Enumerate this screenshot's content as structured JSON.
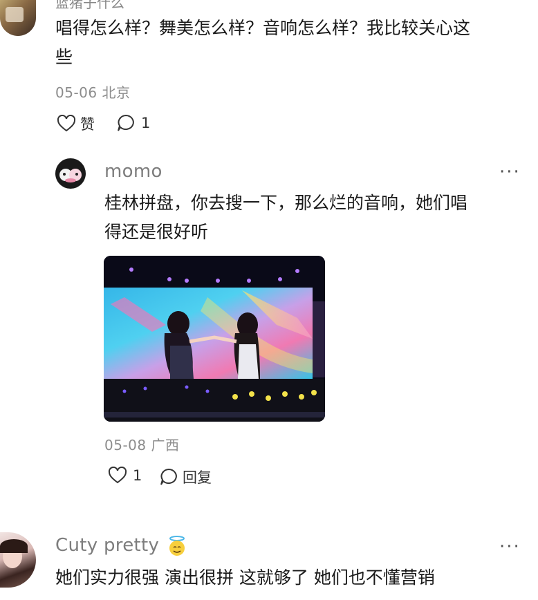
{
  "comment1": {
    "username_partial": "蓝猪子什么",
    "text": "唱得怎么样？舞美怎么样？音响怎么样？我比较关心这些",
    "text_line1": "唱得怎么样？舞美怎么样？音响怎么样？我比较关心这",
    "text_line2": "些",
    "date_location": "05-06 北京",
    "like_label": "赞",
    "reply_count": "1"
  },
  "reply": {
    "username": "momo",
    "more": "···",
    "text_line1": "桂林拼盘，你去搜一下，那么烂的音响，她们唱",
    "text_line2": "得还是很好听",
    "date_location": "05-08 广西",
    "like_count": "1",
    "reply_label": "回复"
  },
  "comment2": {
    "username": "Cuty pretty",
    "badge_icon": "angel-emoji",
    "more": "···",
    "text": "她们实力很强 演出很拼 这就够了 她们也不懂营销"
  },
  "colors": {
    "text": "#1a1a1a",
    "meta": "#8c8c8c",
    "username": "#7d7d7d",
    "background": "#ffffff"
  }
}
